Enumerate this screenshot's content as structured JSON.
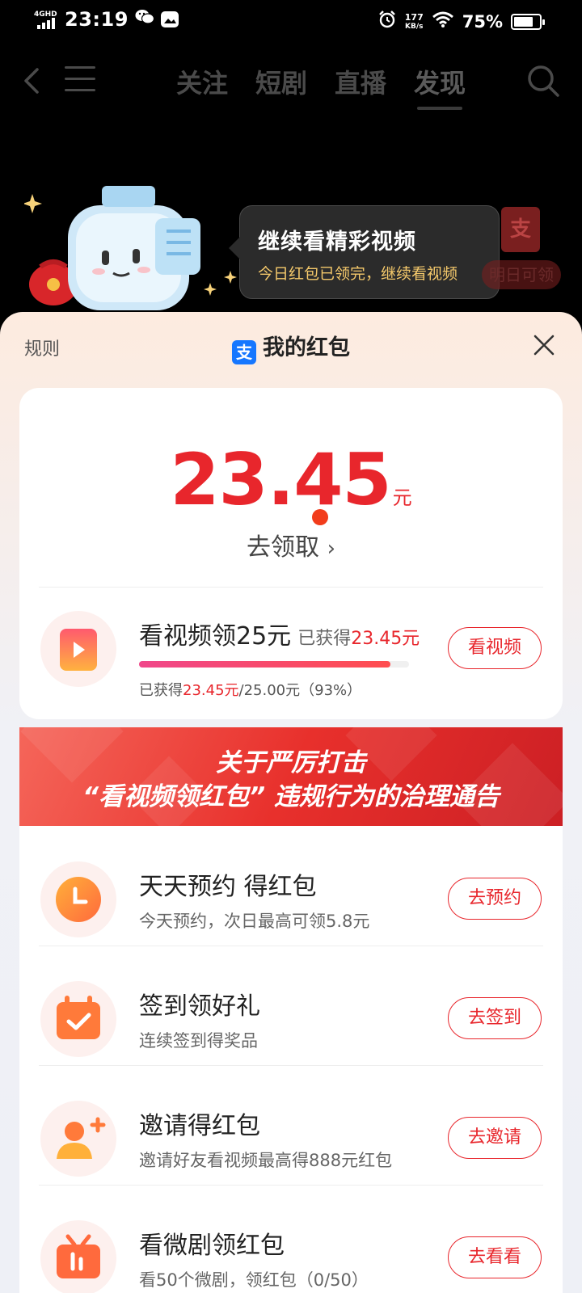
{
  "status_bar": {
    "network": "4GHD",
    "time": "23:19",
    "speed_value": "177",
    "speed_unit": "KB/s",
    "battery": "75%",
    "battery_level": 0.75
  },
  "top_nav": {
    "tabs": [
      {
        "label": "关注"
      },
      {
        "label": "短剧"
      },
      {
        "label": "直播"
      },
      {
        "label": "发现"
      }
    ],
    "active_tab": "发现"
  },
  "promo": {
    "tooltip_title": "继续看精彩视频",
    "tooltip_subtitle": "今日红包已领完，继续看视频",
    "tomorrow_label": "明日可领",
    "alipay_glyph": "支"
  },
  "sheet": {
    "rules": "规则",
    "title": "我的红包",
    "alipay_glyph": "支"
  },
  "balance": {
    "amount": "23.45",
    "unit": "元",
    "claim_label": "去领取",
    "claim_chevron": "›"
  },
  "watch_task": {
    "title": "看视频领25元",
    "earned_prefix": "已获得",
    "earned_value": "23.45元",
    "progress_prefix": "已获得",
    "progress_value": "23.45元",
    "progress_total": "/25.00元（93%）",
    "progress_fraction": 0.93,
    "button": "看视频"
  },
  "notice": {
    "line1": "关于严厉打击",
    "line2": "“看视频领红包” 违规行为的治理通告"
  },
  "tasks": [
    {
      "icon": "clock-icon",
      "title": "天天预约 得红包",
      "subtitle": "今天预约，次日最高可领5.8元",
      "button": "去预约"
    },
    {
      "icon": "calendar-check-icon",
      "title": "签到领好礼",
      "subtitle": "连续签到得奖品",
      "button": "去签到"
    },
    {
      "icon": "user-add-icon",
      "title": "邀请得红包",
      "subtitle": "邀请好友看视频最高得888元红包",
      "button": "去邀请"
    },
    {
      "icon": "tv-icon",
      "title": "看微剧领红包",
      "subtitle": "看50个微剧，领红包（0/50）",
      "button": "去看看"
    }
  ],
  "colors": {
    "accent_red": "#e8262c",
    "alipay_blue": "#1677ff",
    "tooltip_yellow": "#f5c96b",
    "icon_orange": "#ff8a1f"
  }
}
